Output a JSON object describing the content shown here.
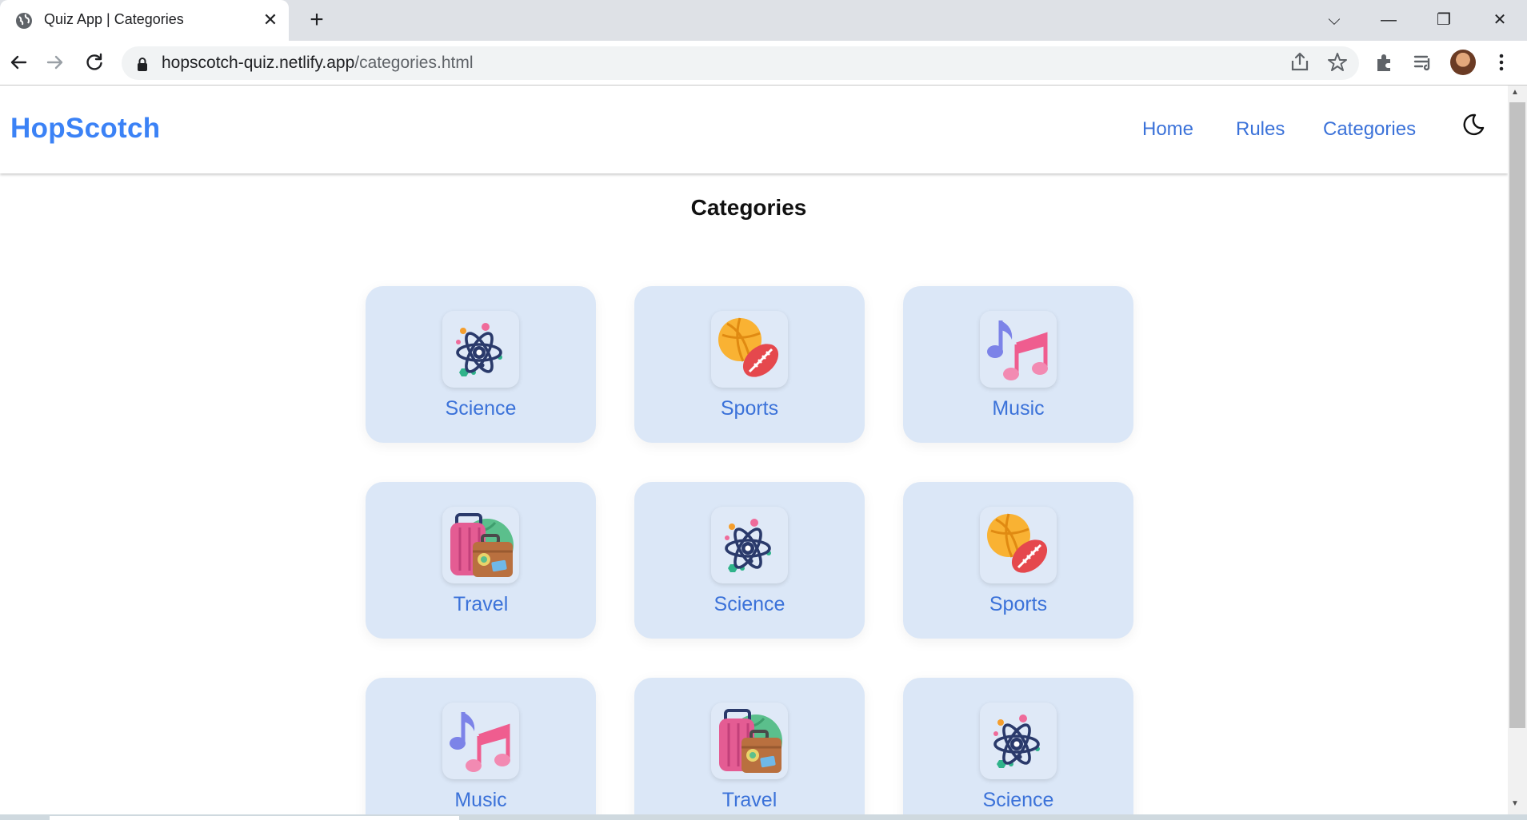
{
  "browser": {
    "tab_title": "Quiz App | Categories",
    "url_host": "hopscotch-quiz.netlify.app",
    "url_path": "/categories.html"
  },
  "navbar": {
    "brand": "HopScotch",
    "links": [
      {
        "label": "Home"
      },
      {
        "label": "Rules"
      },
      {
        "label": "Categories"
      }
    ],
    "theme_icon": "moon-icon"
  },
  "page": {
    "title": "Categories"
  },
  "categories": [
    {
      "label": "Science",
      "icon": "atom-icon"
    },
    {
      "label": "Sports",
      "icon": "sports-balls-icon"
    },
    {
      "label": "Music",
      "icon": "music-notes-icon"
    },
    {
      "label": "Travel",
      "icon": "luggage-icon"
    },
    {
      "label": "Science",
      "icon": "atom-icon"
    },
    {
      "label": "Sports",
      "icon": "sports-balls-icon"
    },
    {
      "label": "Music",
      "icon": "music-notes-icon"
    },
    {
      "label": "Travel",
      "icon": "luggage-icon"
    },
    {
      "label": "Science",
      "icon": "atom-icon"
    }
  ],
  "colors": {
    "brand": "#3b82f6",
    "link": "#3b72d9",
    "card_bg": "#dbe7f7"
  }
}
